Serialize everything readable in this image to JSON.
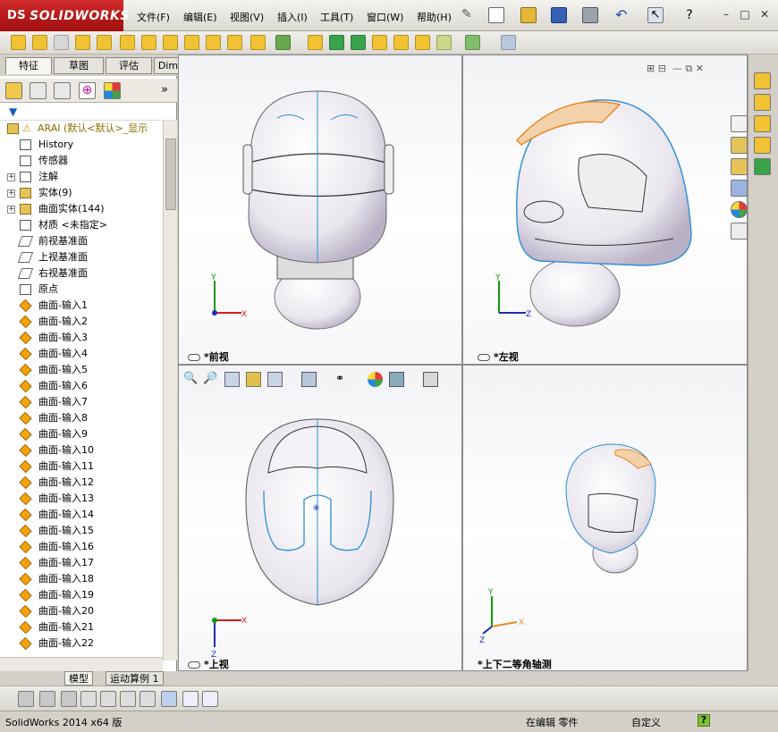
{
  "app": {
    "brand": "SOLIDWORKS",
    "brand_prefix": "DS"
  },
  "menu": [
    {
      "label": "文件(F)"
    },
    {
      "label": "编辑(E)"
    },
    {
      "label": "视图(V)"
    },
    {
      "label": "插入(I)"
    },
    {
      "label": "工具(T)"
    },
    {
      "label": "窗口(W)"
    },
    {
      "label": "帮助(H)"
    }
  ],
  "command_manager_tabs": [
    {
      "label": "特征",
      "active": true
    },
    {
      "label": "草图"
    },
    {
      "label": "评估"
    },
    {
      "label": "DimXpert"
    }
  ],
  "feature_tree": {
    "root": "ARAI (默认<默认>_显示",
    "items": [
      {
        "label": "History",
        "icon": "history-icon",
        "expandable": false
      },
      {
        "label": "传感器",
        "icon": "sensor-icon",
        "expandable": false
      },
      {
        "label": "注解",
        "icon": "annotation-icon",
        "expandable": true
      },
      {
        "label": "实体(9)",
        "icon": "solid-bodies-icon",
        "expandable": true
      },
      {
        "label": "曲面实体(144)",
        "icon": "surface-bodies-icon",
        "expandable": true
      },
      {
        "label": "材质 <未指定>",
        "icon": "material-icon",
        "expandable": false
      },
      {
        "label": "前视基准面",
        "icon": "plane-icon",
        "expandable": false
      },
      {
        "label": "上视基准面",
        "icon": "plane-icon",
        "expandable": false
      },
      {
        "label": "右视基准面",
        "icon": "plane-icon",
        "expandable": false
      },
      {
        "label": "原点",
        "icon": "origin-icon",
        "expandable": false
      },
      {
        "label": "曲面-输入1",
        "icon": "surface-icon",
        "expandable": false
      },
      {
        "label": "曲面-输入2",
        "icon": "surface-icon",
        "expandable": false
      },
      {
        "label": "曲面-输入3",
        "icon": "surface-icon",
        "expandable": false
      },
      {
        "label": "曲面-输入4",
        "icon": "surface-icon",
        "expandable": false
      },
      {
        "label": "曲面-输入5",
        "icon": "surface-icon",
        "expandable": false
      },
      {
        "label": "曲面-输入6",
        "icon": "surface-icon",
        "expandable": false
      },
      {
        "label": "曲面-输入7",
        "icon": "surface-icon",
        "expandable": false
      },
      {
        "label": "曲面-输入8",
        "icon": "surface-icon",
        "expandable": false
      },
      {
        "label": "曲面-输入9",
        "icon": "surface-icon",
        "expandable": false
      },
      {
        "label": "曲面-输入10",
        "icon": "surface-icon",
        "expandable": false
      },
      {
        "label": "曲面-输入11",
        "icon": "surface-icon",
        "expandable": false
      },
      {
        "label": "曲面-输入12",
        "icon": "surface-icon",
        "expandable": false
      },
      {
        "label": "曲面-输入13",
        "icon": "surface-icon",
        "expandable": false
      },
      {
        "label": "曲面-输入14",
        "icon": "surface-icon",
        "expandable": false
      },
      {
        "label": "曲面-输入15",
        "icon": "surface-icon",
        "expandable": false
      },
      {
        "label": "曲面-输入16",
        "icon": "surface-icon",
        "expandable": false
      },
      {
        "label": "曲面-输入17",
        "icon": "surface-icon",
        "expandable": false
      },
      {
        "label": "曲面-输入18",
        "icon": "surface-icon",
        "expandable": false
      },
      {
        "label": "曲面-输入19",
        "icon": "surface-icon",
        "expandable": false
      },
      {
        "label": "曲面-输入20",
        "icon": "surface-icon",
        "expandable": false
      },
      {
        "label": "曲面-输入21",
        "icon": "surface-icon",
        "expandable": false
      },
      {
        "label": "曲面-输入22",
        "icon": "surface-icon",
        "expandable": false
      }
    ]
  },
  "model_tabs": [
    {
      "label": "模型",
      "active": true
    },
    {
      "label": "运动算例 1"
    }
  ],
  "viewports": {
    "front": {
      "label": "*前视"
    },
    "left": {
      "label": "*左视"
    },
    "top": {
      "label": "*上视"
    },
    "iso": {
      "label": "*上下二等角轴测"
    }
  },
  "axes": {
    "x": "X",
    "y": "Y",
    "z": "Z"
  },
  "status": {
    "version": "SolidWorks 2014 x64 版",
    "editing": "在编辑 零件",
    "units": "自定义",
    "help": "?"
  },
  "colors": {
    "accent_red": "#b51a1a",
    "surface_orange": "#f6a20b",
    "helmet_edge_blue": "#2a8fd6",
    "helmet_top_orange": "#e98a2a"
  }
}
